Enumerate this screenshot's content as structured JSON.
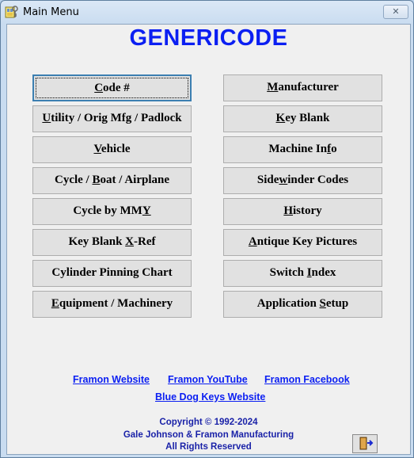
{
  "window": {
    "title": "Main Menu",
    "close_symbol": "✕"
  },
  "heading": "GENERICODE",
  "left_buttons": [
    {
      "pre": "",
      "u": "C",
      "post": "ode #"
    },
    {
      "pre": "",
      "u": "U",
      "post": "tility / Orig  Mfg / Padlock"
    },
    {
      "pre": "",
      "u": "V",
      "post": "ehicle"
    },
    {
      "pre": "Cycle / ",
      "u": "B",
      "post": "oat / Airplane"
    },
    {
      "pre": "Cycle by MM",
      "u": "Y",
      "post": ""
    },
    {
      "pre": "Key Blank ",
      "u": "X",
      "post": "-Ref"
    },
    {
      "pre": "Cylinder Pinning Chart",
      "u": "",
      "post": ""
    },
    {
      "pre": "",
      "u": "E",
      "post": "quipment / Machinery"
    }
  ],
  "right_buttons": [
    {
      "pre": "",
      "u": "M",
      "post": "anufacturer"
    },
    {
      "pre": "",
      "u": "K",
      "post": "ey Blank"
    },
    {
      "pre": "Machine In",
      "u": "f",
      "post": "o"
    },
    {
      "pre": "Side",
      "u": "w",
      "post": "inder Codes"
    },
    {
      "pre": "",
      "u": "H",
      "post": "istory"
    },
    {
      "pre": "",
      "u": "A",
      "post": "ntique Key Pictures"
    },
    {
      "pre": "Switch ",
      "u": "I",
      "post": "ndex"
    },
    {
      "pre": "Application ",
      "u": "S",
      "post": "etup"
    }
  ],
  "links": {
    "website": "Framon Website",
    "youtube": "Framon YouTube",
    "facebook": "Framon Facebook",
    "bluedog": "Blue Dog Keys Website"
  },
  "copyright": {
    "line1": "Copyright © 1992-2024",
    "line2": "Gale Johnson & Framon Manufacturing",
    "line3": "All Rights Reserved"
  },
  "colors": {
    "heading": "#0b1ff2",
    "link": "#0b1ff2",
    "copyright": "#1a22a8"
  },
  "icons": {
    "title": "key-icon",
    "exit": "exit-door-icon"
  }
}
